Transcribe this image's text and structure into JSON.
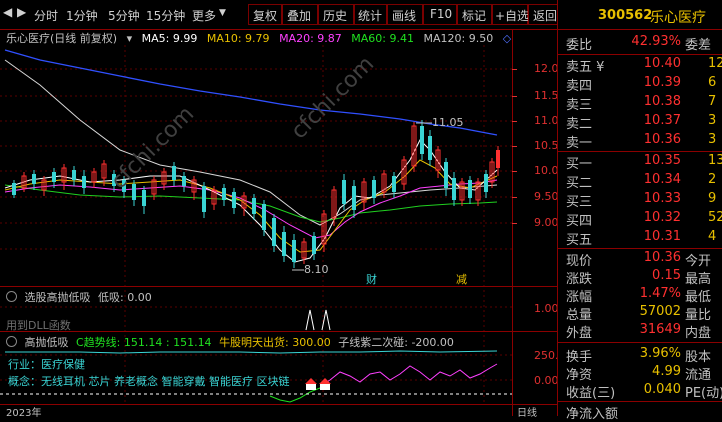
{
  "toolbar": {
    "items": [
      {
        "label": "分时"
      },
      {
        "label": "1分钟"
      },
      {
        "label": "5分钟"
      },
      {
        "label": "15分钟"
      },
      {
        "label": "更多"
      },
      {
        "label": "复权"
      },
      {
        "label": "叠加"
      },
      {
        "label": "历史"
      },
      {
        "label": "统计"
      },
      {
        "label": "画线"
      },
      {
        "label": "F10"
      },
      {
        "label": "标记"
      },
      {
        "label": "+自选"
      },
      {
        "label": "返回"
      }
    ]
  },
  "kline": {
    "title": "乐心医疗(日线 前复权)",
    "ma": [
      {
        "label": "MA5: 9.99",
        "color": "#ffffff"
      },
      {
        "label": "MA10: 9.79",
        "color": "#e8c000"
      },
      {
        "label": "MA20: 9.87",
        "color": "#ff40ff"
      },
      {
        "label": "MA60: 9.41",
        "color": "#20e020"
      },
      {
        "label": "MA120: 9.50",
        "color": "#c0c0c0"
      }
    ],
    "axis": [
      "12.00",
      "11.50",
      "11.00",
      "10.50",
      "10.00",
      "9.50",
      "9.00"
    ],
    "high_label": "11.05",
    "low_label": "8.10",
    "marker_cai": "财",
    "marker_jian": "减"
  },
  "indicator1": {
    "title": "选股高抛低吸",
    "value": "低吸: 0.00",
    "axis": "1.00",
    "footer": "用到DLL函数"
  },
  "indicator2": {
    "title": "高抛低吸",
    "c_trend": "C趋势线: 151.14 : 151.14",
    "bull": "牛股明天出货: 300.00",
    "secondary": "子线紫二次碰: -200.00",
    "axis": [
      "250.0",
      "0.00"
    ],
    "industry": "行业：医疗保健",
    "concept": "概念：无线耳机 芯片 养老概念 智能穿戴 智能医疗 区块链"
  },
  "bottom_axis": {
    "left": "2023年",
    "right": "日线"
  },
  "quote": {
    "code": "300562",
    "name": "乐心医疗",
    "weibi_label": "委比",
    "weibi_value": "42.93%",
    "weicha_label": "委差",
    "sell": [
      {
        "label": "卖五 ¥",
        "price": "10.40",
        "vol": "12"
      },
      {
        "label": "卖四",
        "price": "10.39",
        "vol": "6"
      },
      {
        "label": "卖三",
        "price": "10.38",
        "vol": "7"
      },
      {
        "label": "卖二",
        "price": "10.37",
        "vol": "3"
      },
      {
        "label": "卖一",
        "price": "10.36",
        "vol": "3"
      }
    ],
    "buy": [
      {
        "label": "买一",
        "price": "10.35",
        "vol": "13"
      },
      {
        "label": "买二",
        "price": "10.34",
        "vol": "2"
      },
      {
        "label": "买三",
        "price": "10.33",
        "vol": "9"
      },
      {
        "label": "买四",
        "price": "10.32",
        "vol": "52"
      },
      {
        "label": "买五",
        "price": "10.31",
        "vol": "4"
      }
    ],
    "stats": [
      {
        "label": "现价",
        "value": "10.36",
        "label2": "今开",
        "color": "#ff3030"
      },
      {
        "label": "涨跌",
        "value": "0.15",
        "label2": "最高",
        "color": "#ff3030"
      },
      {
        "label": "涨幅",
        "value": "1.47%",
        "label2": "最低",
        "color": "#ff3030"
      },
      {
        "label": "总量",
        "value": "57002",
        "label2": "量比",
        "color": "#e8c000"
      },
      {
        "label": "外盘",
        "value": "31649",
        "label2": "内盘",
        "color": "#ff3030"
      }
    ],
    "stats2": [
      {
        "label": "换手",
        "value": "3.96%",
        "label2": "股本"
      },
      {
        "label": "净资",
        "value": "4.99",
        "label2": "流通"
      },
      {
        "label": "收益(三)",
        "value": "0.040",
        "label2": "PE(动)"
      }
    ],
    "footer": "净流入额"
  }
}
